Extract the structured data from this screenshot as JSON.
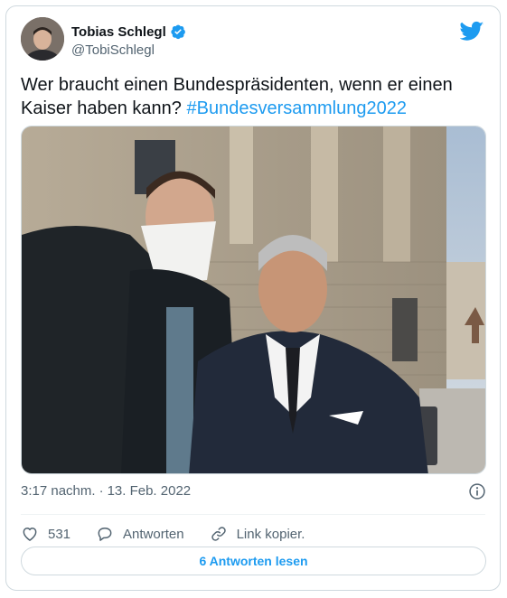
{
  "author": {
    "display_name": "Tobias Schlegl",
    "handle": "@TobiSchlegl",
    "verified_icon": "verified-badge-icon",
    "avatar_icon": "avatar"
  },
  "brand": {
    "icon": "twitter-bird-icon",
    "color": "#1d9bf0"
  },
  "tweet": {
    "text": "Wer braucht einen Bundespräsidenten, wenn er einen Kaiser haben kann?",
    "hashtag": "#Bundesversammlung2022"
  },
  "media": {
    "type": "photo",
    "icon": "photo-image"
  },
  "meta": {
    "time": "3:17 nachm.",
    "date": "13. Feb. 2022",
    "info_icon": "info-icon"
  },
  "actions": {
    "like_count": "531",
    "reply_label": "Antworten",
    "copy_link_label": "Link kopier."
  },
  "read_replies_label": "6 Antworten lesen",
  "colors": {
    "text": "#0f1419",
    "secondary": "#536471",
    "accent": "#1d9bf0",
    "border": "#cfd9de"
  }
}
